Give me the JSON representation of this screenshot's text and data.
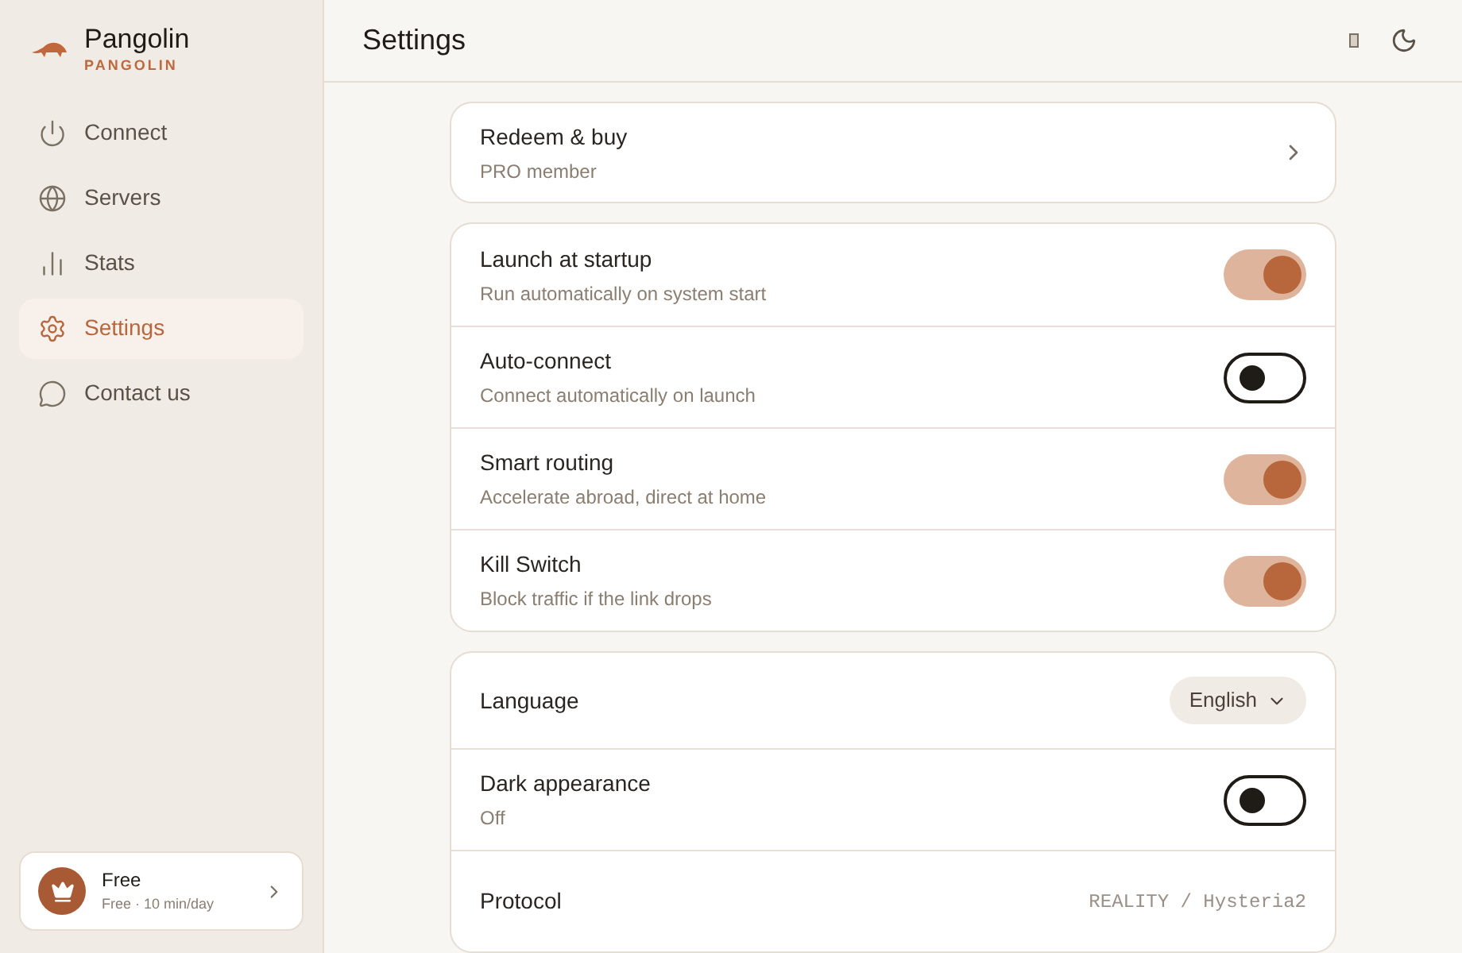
{
  "brand": {
    "name": "Pangolin",
    "tagline": "PANGOLIN"
  },
  "nav": [
    {
      "label": "Connect",
      "selected": false
    },
    {
      "label": "Servers",
      "selected": false
    },
    {
      "label": "Stats",
      "selected": false
    },
    {
      "label": "Settings",
      "selected": true
    },
    {
      "label": "Contact us",
      "selected": false
    }
  ],
  "plan": {
    "title": "Free",
    "subtitle": "Free · 10 min/day"
  },
  "header": {
    "title": "Settings"
  },
  "groups": [
    {
      "rows": [
        {
          "kind": "link",
          "label": "Redeem & buy",
          "sublabel": "PRO member"
        }
      ]
    },
    {
      "rows": [
        {
          "kind": "toggle",
          "label": "Launch at startup",
          "sublabel": "Run automatically on system start",
          "on": true
        },
        {
          "kind": "toggle",
          "label": "Auto-connect",
          "sublabel": "Connect automatically on launch",
          "on": false
        },
        {
          "kind": "toggle",
          "label": "Smart routing",
          "sublabel": "Accelerate abroad, direct at home",
          "on": true
        },
        {
          "kind": "toggle",
          "label": "Kill Switch",
          "sublabel": "Block traffic if the link drops",
          "on": true
        }
      ]
    },
    {
      "rows": [
        {
          "kind": "select",
          "label": "Language",
          "value": "English"
        },
        {
          "kind": "toggle",
          "label": "Dark appearance",
          "sublabel": "Off",
          "on": false
        },
        {
          "kind": "value",
          "label": "Protocol",
          "value": "REALITY / Hysteria2"
        }
      ]
    }
  ]
}
